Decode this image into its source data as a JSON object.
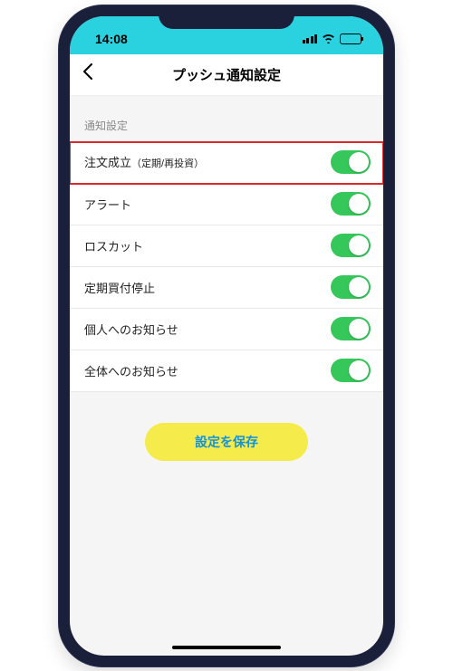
{
  "status": {
    "time": "14:08"
  },
  "header": {
    "title": "プッシュ通知設定"
  },
  "section_label": "通知設定",
  "settings": [
    {
      "label": "注文成立",
      "sub": "（定期/再投資）",
      "on": true,
      "highlighted": true
    },
    {
      "label": "アラート",
      "sub": "",
      "on": true,
      "highlighted": false
    },
    {
      "label": "ロスカット",
      "sub": "",
      "on": true,
      "highlighted": false
    },
    {
      "label": "定期買付停止",
      "sub": "",
      "on": true,
      "highlighted": false
    },
    {
      "label": "個人へのお知らせ",
      "sub": "",
      "on": true,
      "highlighted": false
    },
    {
      "label": "全体へのお知らせ",
      "sub": "",
      "on": true,
      "highlighted": false
    }
  ],
  "save_button": "設定を保存",
  "colors": {
    "status_bar": "#2ad2e0",
    "toggle_on": "#35c759",
    "save_bg": "#f5eb4a",
    "save_text": "#1592d6",
    "highlight_border": "#d82a2a"
  }
}
